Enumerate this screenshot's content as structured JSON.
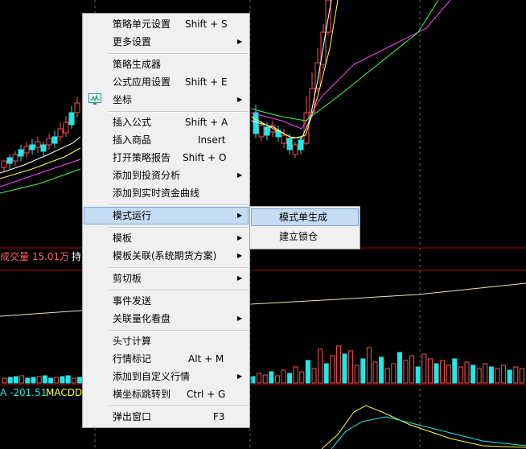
{
  "indicators": {
    "volume_label": "成交量 15.01万",
    "hold_label": "持",
    "macd_value": "A -201.51",
    "macd_label": "MACDD"
  },
  "colors": {
    "up": "#ff5050",
    "down": "#20e8e8",
    "ma_white": "#ffffff",
    "ma_yellow": "#ffff40",
    "ma_magenta": "#ff40ff",
    "ma_green": "#40ff40",
    "grid": "#8b0000",
    "menu_bg": "#f0f0f0",
    "menu_highlight": "#c5dcf3"
  },
  "context_menu": {
    "items": [
      {
        "label": "策略单元设置",
        "shortcut": "Shift + S"
      },
      {
        "label": "更多设置",
        "submenu": true
      },
      {
        "label": "策略生成器"
      },
      {
        "label": "公式应用设置",
        "shortcut": "Shift + E"
      },
      {
        "label": "坐标",
        "submenu": true,
        "icon": "monitor-chart-icon"
      },
      {
        "label": "插入公式",
        "shortcut": "Shift + A"
      },
      {
        "label": "插入商品",
        "shortcut": "Insert"
      },
      {
        "label": "打开策略报告",
        "shortcut": "Shift + O"
      },
      {
        "label": "添加到投资分析",
        "submenu": true
      },
      {
        "label": "添加到实时资金曲线"
      },
      {
        "label": "模式运行",
        "submenu": true,
        "selected": true
      },
      {
        "label": "模板",
        "submenu": true
      },
      {
        "label": "模板关联(系统期货方案)",
        "submenu": true
      },
      {
        "label": "剪切板",
        "submenu": true
      },
      {
        "label": "事件发送"
      },
      {
        "label": "关联量化看盘",
        "submenu": true
      },
      {
        "label": "头寸计算"
      },
      {
        "label": "行情标记",
        "shortcut": "Alt + M"
      },
      {
        "label": "添加到自定义行情",
        "submenu": true
      },
      {
        "label": "横坐标跳转到",
        "shortcut": "Ctrl + G"
      },
      {
        "label": "弹出窗口",
        "shortcut": "F3"
      }
    ]
  },
  "submenu": {
    "items": [
      {
        "label": "模式单生成",
        "selected": true
      },
      {
        "label": "建立锁仓"
      }
    ]
  }
}
